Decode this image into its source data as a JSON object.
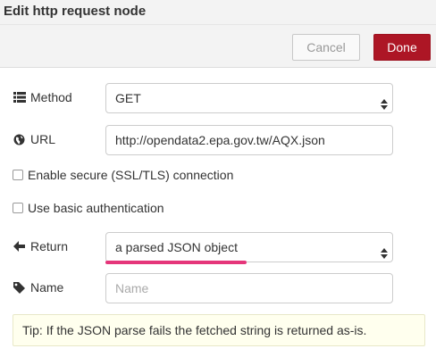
{
  "dialog": {
    "title": "Edit http request node"
  },
  "toolbar": {
    "cancel_label": "Cancel",
    "done_label": "Done"
  },
  "form": {
    "method": {
      "label": "Method",
      "value": "GET",
      "icon": "list-icon"
    },
    "url": {
      "label": "URL",
      "value": "http://opendata2.epa.gov.tw/AQX.json",
      "icon": "globe-icon"
    },
    "tls": {
      "label": "Enable secure (SSL/TLS) connection",
      "checked": false
    },
    "auth": {
      "label": "Use basic authentication",
      "checked": false
    },
    "return": {
      "label": "Return",
      "value": "a parsed JSON object",
      "icon": "arrow-left-icon"
    },
    "name": {
      "label": "Name",
      "value": "",
      "placeholder": "Name",
      "icon": "tag-icon"
    }
  },
  "tip": {
    "text": "Tip: If the JSON parse fails the fetched string is returned as-is."
  },
  "colors": {
    "done": "#ad1625",
    "highlight": "#e5367a",
    "tip_bg": "#ffffee"
  }
}
